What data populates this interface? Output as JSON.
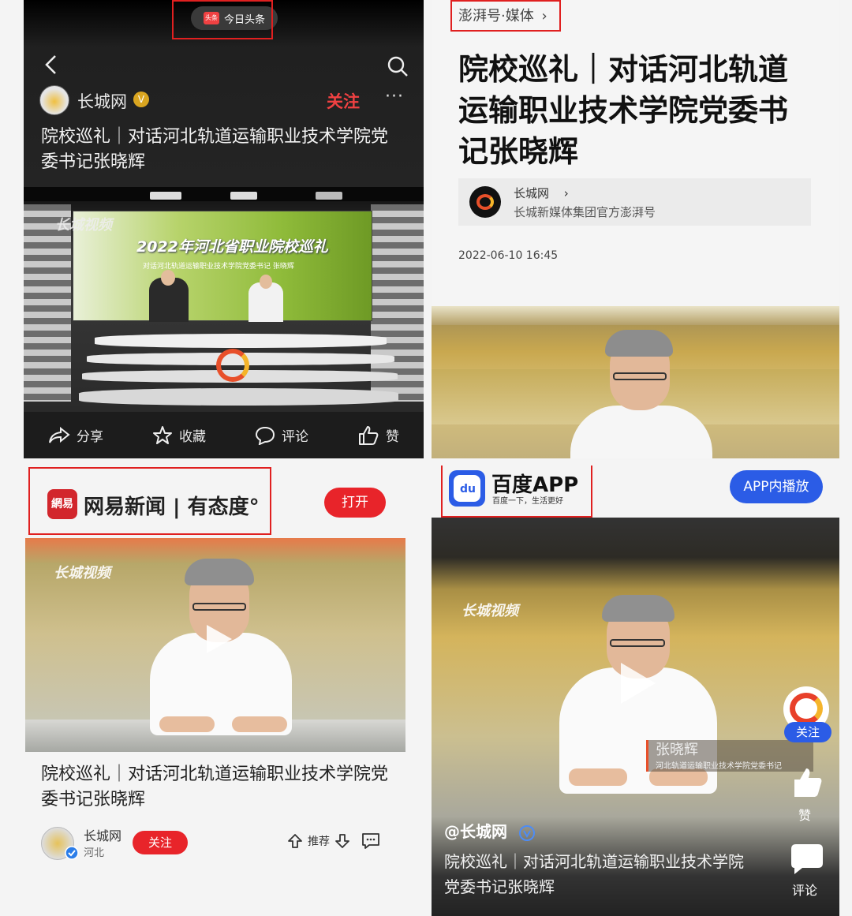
{
  "toutiao": {
    "app_badge": "今日头条",
    "app_badge_icon_text": "头条",
    "source_name": "长城网",
    "verified_mark": "V",
    "follow_label": "关注",
    "more_label": "···",
    "title": "院校巡礼｜对话河北轨道运输职业技术学院党委书记张晓辉",
    "video_watermark": "长城视频",
    "video_banner_title": "2022年河北省职业院校巡礼",
    "video_banner_sub": "对话河北轨道运输职业技术学院党委书记 张晓辉",
    "actions": [
      {
        "label": "分享",
        "icon": "share-icon"
      },
      {
        "label": "收藏",
        "icon": "star-icon"
      },
      {
        "label": "评论",
        "icon": "comment-icon"
      },
      {
        "label": "赞",
        "icon": "thumbs-up-icon"
      }
    ]
  },
  "pengpai": {
    "header": "澎湃号·媒体",
    "header_arrow": "›",
    "title": "院校巡礼｜对话河北轨道运输职业技术学院党委书记张晓辉",
    "source_name": "长城网",
    "source_arrow": "›",
    "source_desc": "长城新媒体集团官方澎湃号",
    "date": "2022-06-10 16:45"
  },
  "netease": {
    "logo_text": "網易",
    "brand": "网易新闻 | 有态度°",
    "open_label": "打开",
    "video_watermark": "长城视频",
    "title": "院校巡礼｜对话河北轨道运输职业技术学院党委书记张晓辉",
    "source_name": "长城网",
    "region": "河北",
    "follow_label": "关注",
    "recommend_label": "推荐"
  },
  "baidu": {
    "brand": "百度APP",
    "slogan": "百度一下，生活更好",
    "logo_text": "du",
    "play_label": "APP内播放",
    "video_watermark": "长城视频",
    "person_name": "张晓辉",
    "person_role": "河北轨道运输职业技术学院党委书记",
    "follow_label": "关注",
    "like_label": "赞",
    "comment_label": "评论",
    "user_handle": "@长城网",
    "caption": "院校巡礼｜对话河北轨道运输职业技术学院党委书记张晓辉"
  },
  "colors": {
    "toutiao_red": "#f04142",
    "netease_red": "#e8242a",
    "baidu_blue": "#2b5ce6",
    "annotation_red": "#e02020"
  }
}
